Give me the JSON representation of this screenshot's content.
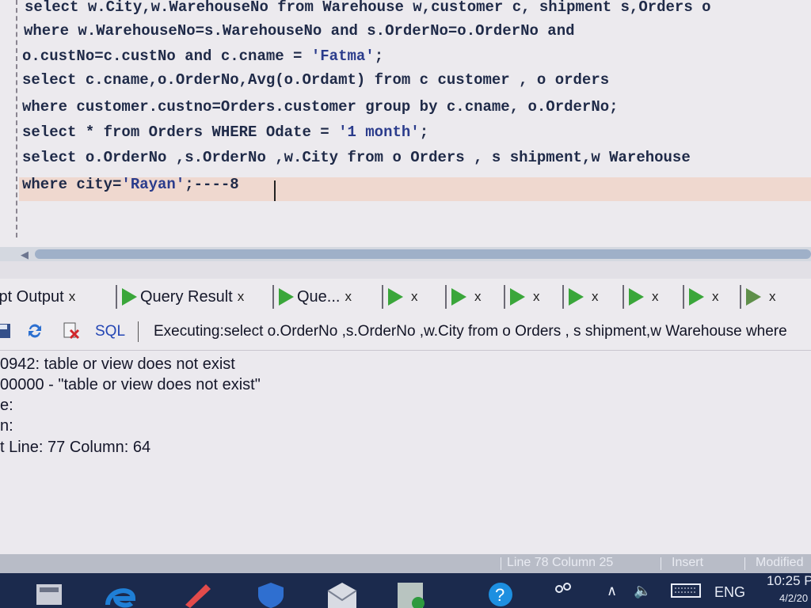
{
  "editor": {
    "lines": [
      {
        "parts": [
          {
            "t": "select w.City,w.WarehouseNo from Warehouse w,customer c, shipment s,Orders o"
          }
        ]
      },
      {
        "parts": [
          {
            "t": "where w.WarehouseNo=s.WarehouseNo and s.OrderNo=o.OrderNo and"
          }
        ]
      },
      {
        "parts": [
          {
            "t": "o.custNo=c.custNo and c.cname = "
          },
          {
            "t": "'Fatma'",
            "s": true
          },
          {
            "t": ";"
          }
        ]
      },
      {
        "parts": [
          {
            "t": "select c.cname,o.OrderNo,Avg(o.Ordamt) from c customer , o orders"
          }
        ]
      },
      {
        "parts": [
          {
            "t": "where customer.custno=Orders.customer group by c.cname, o.OrderNo;"
          }
        ]
      },
      {
        "parts": [
          {
            "t": "select * from Orders WHERE Odate = "
          },
          {
            "t": "'1 month'",
            "s": true
          },
          {
            "t": ";"
          }
        ]
      },
      {
        "parts": [
          {
            "t": "select o.OrderNo ,s.OrderNo ,w.City from o Orders , s shipment,w Warehouse"
          }
        ]
      },
      {
        "parts": [
          {
            "t": "where city="
          },
          {
            "t": "'Rayan'",
            "s": true
          },
          {
            "t": ";----8"
          }
        ]
      }
    ]
  },
  "tabs": [
    {
      "label": "ipt Output",
      "icon": "none",
      "close": "x"
    },
    {
      "label": "Query Result",
      "icon": "run-icon",
      "close": "x"
    },
    {
      "label": "Que...",
      "icon": "run-icon",
      "close": "x"
    },
    {
      "label": "",
      "icon": "run-icon",
      "close": "x"
    },
    {
      "label": "",
      "icon": "run-icon",
      "close": "x"
    },
    {
      "label": "",
      "icon": "run-icon",
      "close": "x"
    },
    {
      "label": "",
      "icon": "run-icon",
      "close": "x"
    },
    {
      "label": "",
      "icon": "run-icon",
      "close": "x"
    },
    {
      "label": "",
      "icon": "run-icon",
      "close": "x"
    },
    {
      "label": "",
      "icon": "run-error-icon",
      "close": "x"
    }
  ],
  "toolbar": {
    "sql_label": "SQL",
    "status": "Executing:select o.OrderNo ,s.OrderNo ,w.City from o Orders , s shipment,w Warehouse where"
  },
  "output": {
    "lines": [
      "0942: table or view does not exist",
      " 00000 -  \"table or view does not exist\"",
      "e:",
      "n:",
      "t Line: 77 Column: 64"
    ]
  },
  "statusbar": {
    "position": "Line 78 Column 25",
    "mode": "Insert",
    "state": "Modified"
  },
  "taskbar": {
    "language": "ENG",
    "time": "10:25 P",
    "date": "4/2/20"
  },
  "colors": {
    "accent": "#2446b4",
    "run_green": "#3aa63a",
    "taskbar": "#1b2a4d"
  }
}
